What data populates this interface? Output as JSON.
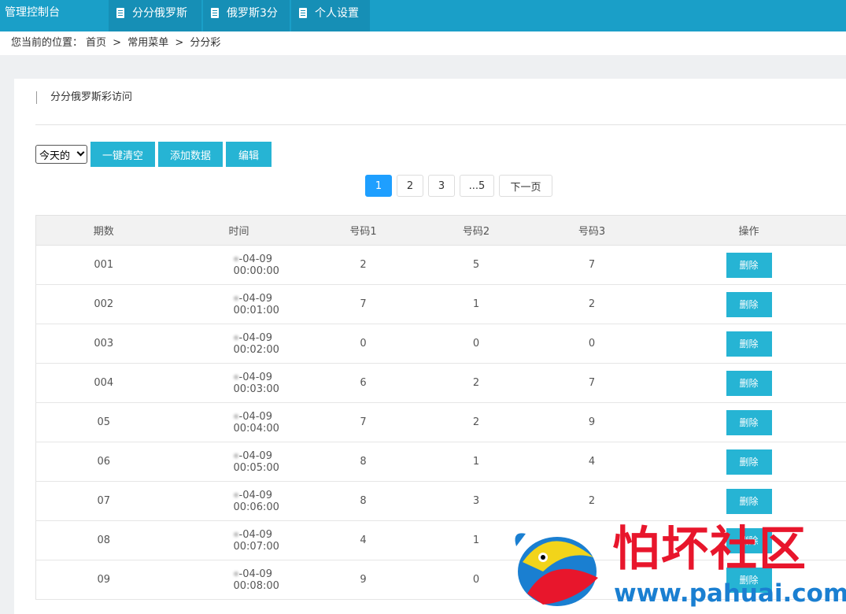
{
  "header": {
    "brand": "管理控制台",
    "tabs": [
      {
        "label": "分分俄罗斯"
      },
      {
        "label": "俄罗斯3分"
      },
      {
        "label": "个人设置"
      }
    ]
  },
  "breadcrumb": {
    "prefix": "您当前的位置：",
    "items": [
      "首页",
      "常用菜单",
      "分分彩"
    ],
    "separator": ">"
  },
  "panel": {
    "title": "分分俄罗斯彩访问"
  },
  "toolbar": {
    "select_value": "今天的",
    "clear_label": "一键清空",
    "add_label": "添加数据",
    "edit_label": "编辑"
  },
  "pager": {
    "pages": [
      "1",
      "2",
      "3",
      "...5"
    ],
    "next_label": "下一页",
    "current": "1"
  },
  "table": {
    "headers": [
      "期数",
      "时间",
      "号码1",
      "号码2",
      "号码3",
      "操作"
    ],
    "delete_label": "删除",
    "rows": [
      {
        "period": "001",
        "time": "-04-09 00:00:00",
        "n1": "2",
        "n2": "5",
        "n3": "7"
      },
      {
        "period": "002",
        "time": "-04-09 00:01:00",
        "n1": "7",
        "n2": "1",
        "n3": "2"
      },
      {
        "period": "003",
        "time": "-04-09 00:02:00",
        "n1": "0",
        "n2": "0",
        "n3": "0"
      },
      {
        "period": "004",
        "time": "-04-09 00:03:00",
        "n1": "6",
        "n2": "2",
        "n3": "7"
      },
      {
        "period": "05",
        "time": "-04-09 00:04:00",
        "n1": "7",
        "n2": "2",
        "n3": "9"
      },
      {
        "period": "06",
        "time": "-04-09 00:05:00",
        "n1": "8",
        "n2": "1",
        "n3": "4"
      },
      {
        "period": "07",
        "time": "-04-09 00:06:00",
        "n1": "8",
        "n2": "3",
        "n3": "2"
      },
      {
        "period": "08",
        "time": "-04-09 00:07:00",
        "n1": "4",
        "n2": "1",
        "n3": ""
      },
      {
        "period": "09",
        "time": "-04-09 00:08:00",
        "n1": "9",
        "n2": "0",
        "n3": ""
      }
    ]
  },
  "watermark": {
    "title": "怕坏社区",
    "url": "www.pahuai.com",
    "colors": {
      "title": "#e8162c",
      "url": "#1a7fd1"
    }
  },
  "colors": {
    "topbar": "#1a9fc8",
    "tab_bg": "#168fb6",
    "button": "#26b4d4",
    "pager_active": "#1e9fff"
  }
}
